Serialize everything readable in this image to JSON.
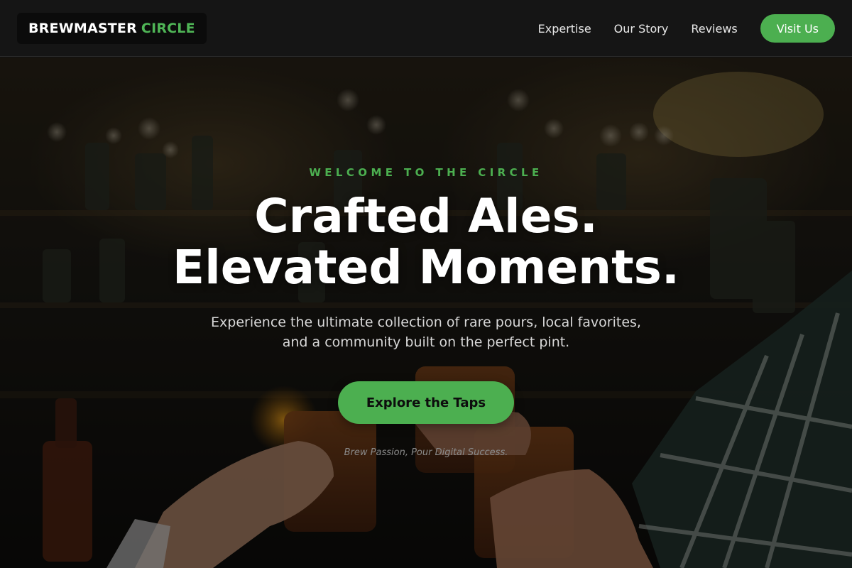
{
  "navbar": {
    "brand_main": "BREWMASTER",
    "brand_accent": "CIRCLE",
    "links": [
      "Expertise",
      "Our Story",
      "Reviews"
    ],
    "visit_label": "Visit Us"
  },
  "hero": {
    "eyebrow": "WELCOME TO THE CIRCLE",
    "headline_line1": "Crafted Ales.",
    "headline_line2": "Elevated Moments.",
    "subtext_line1": "Experience the ultimate collection of rare pours, local favorites,",
    "subtext_line2": "and a community built on the perfect pint.",
    "cta_label": "Explore the Taps",
    "tagline": "Brew Passion, Pour Digital Success."
  },
  "colors": {
    "accent": "#4caf50",
    "navbar_bg": "#151515",
    "brand_bg": "#0b0b0b"
  }
}
